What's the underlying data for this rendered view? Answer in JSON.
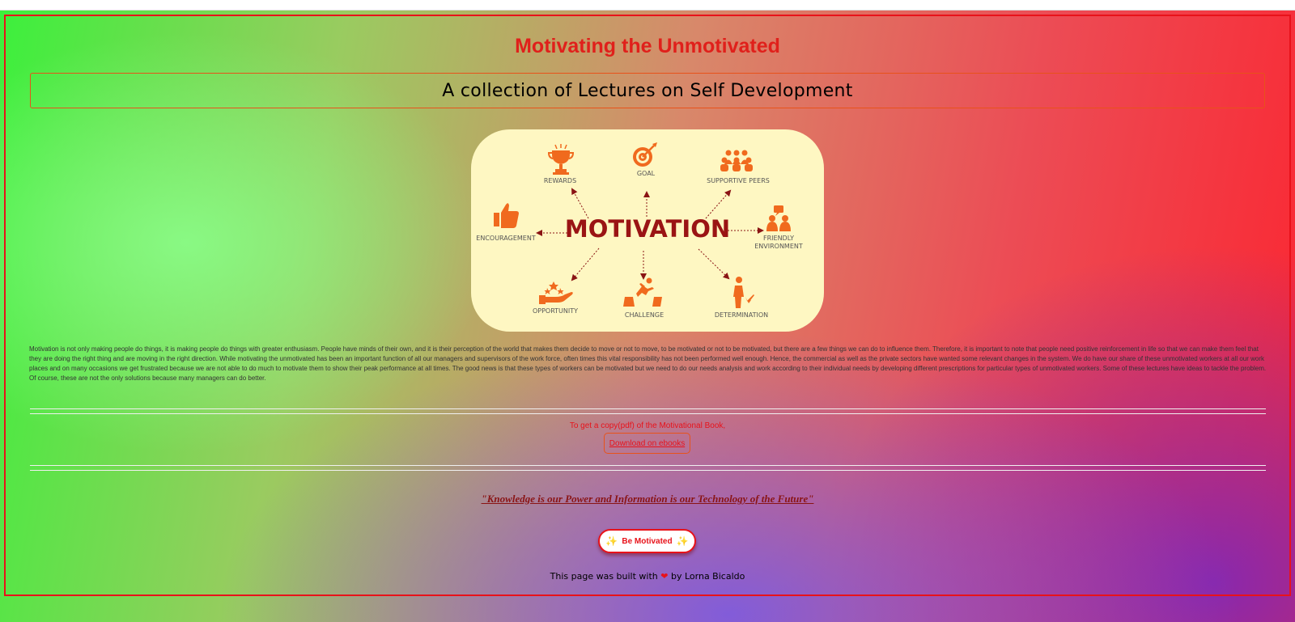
{
  "page": {
    "title": "Motivating the Unmotivated",
    "subtitle": "A collection of Lectures on Self Development"
  },
  "hero": {
    "center_label": "MOTIVATION",
    "items": {
      "rewards": "REWARDS",
      "goal": "GOAL",
      "supportive_peers": "SUPPORTIVE PEERS",
      "encouragement": "ENCOURAGEMENT",
      "friendly_1": "FRIENDLY",
      "friendly_2": "ENVIRONMENT",
      "opportunity": "OPPORTUNITY",
      "challenge": "CHALLENGE",
      "determination": "DETERMINATION"
    },
    "colors": {
      "icon": "#f06a1e",
      "center": "#9a1414",
      "background": "#fef7c2"
    }
  },
  "body": {
    "paragraph": "Motivation is not only making people do things, it is making people do things with greater enthusiasm. People have minds of their own, and it is their perception of the world that makes them decide to move or not to move, to be motivated or not to be motivated, but there are a few things we can do to influence them. Therefore, it is important to note that people need positive reinforcement in life so that we can make them feel that they are doing the right thing and are moving in the right direction. While motivating the unmotivated has been an important function of all our managers and supervisors of the work force, often times this vital responsibility has not been performed well enough. Hence, the commercial as well as the private sectors have wanted some relevant changes in the system. We do have our share of these unmotivated workers at all our work places and on many occasions we get frustrated because we are not able to do much to motivate them to show their peak performance at all times. The good news is that these types of workers can be motivated but we need to do our needs analysis and work according to their individual needs by developing different prescriptions for particular types of unmotivated workers. Some of these lectures have ideas to tackle the problem. Of course, these are not the only solutions because many managers can do better."
  },
  "download": {
    "text": "To get a copy(pdf) of the Motivational Book,",
    "link_label": "Download on ebooks"
  },
  "quote": "\"Knowledge is our Power and Information is our Technology of the Future\"",
  "cta": {
    "label": "Be Motivated",
    "icon": "sparkle-icon"
  },
  "footer": {
    "prefix": "This page was built with",
    "suffix": "by Lorna Bicaldo",
    "icon": "heart-icon"
  },
  "colors": {
    "accent": "#e8121a",
    "quote": "#8a1414"
  }
}
